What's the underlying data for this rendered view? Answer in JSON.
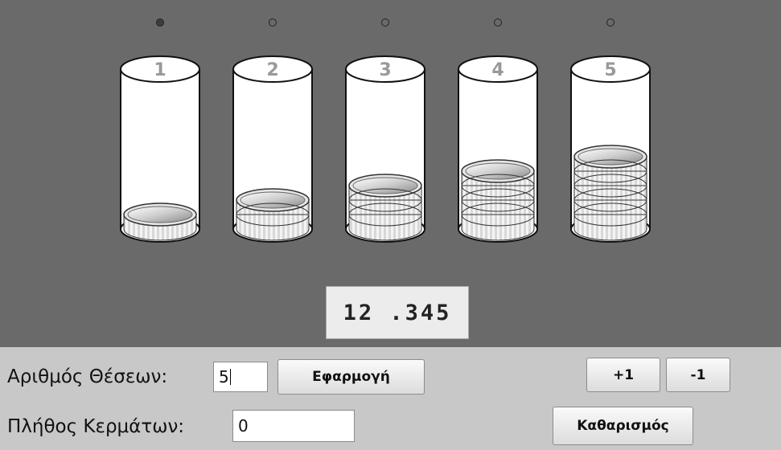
{
  "stage": {
    "columns": [
      {
        "label": "1",
        "coins": 1,
        "selected": true
      },
      {
        "label": "2",
        "coins": 2,
        "selected": false
      },
      {
        "label": "3",
        "coins": 3,
        "selected": false
      },
      {
        "label": "4",
        "coins": 4,
        "selected": false
      },
      {
        "label": "5",
        "coins": 5,
        "selected": false
      }
    ],
    "number_display": "12 .345"
  },
  "controls": {
    "positions_label": "Αριθμός Θέσεων:",
    "positions_value": "5",
    "apply_button": "Εφαρμογή",
    "plus_button": "+1",
    "minus_button": "-1",
    "coins_label": "Πλήθος Κερμάτων:",
    "coins_value": "0",
    "clear_button": "Καθαρισμός"
  },
  "colors": {
    "stage_background": "#6a6a6a",
    "controls_background": "#c8c8c8"
  }
}
